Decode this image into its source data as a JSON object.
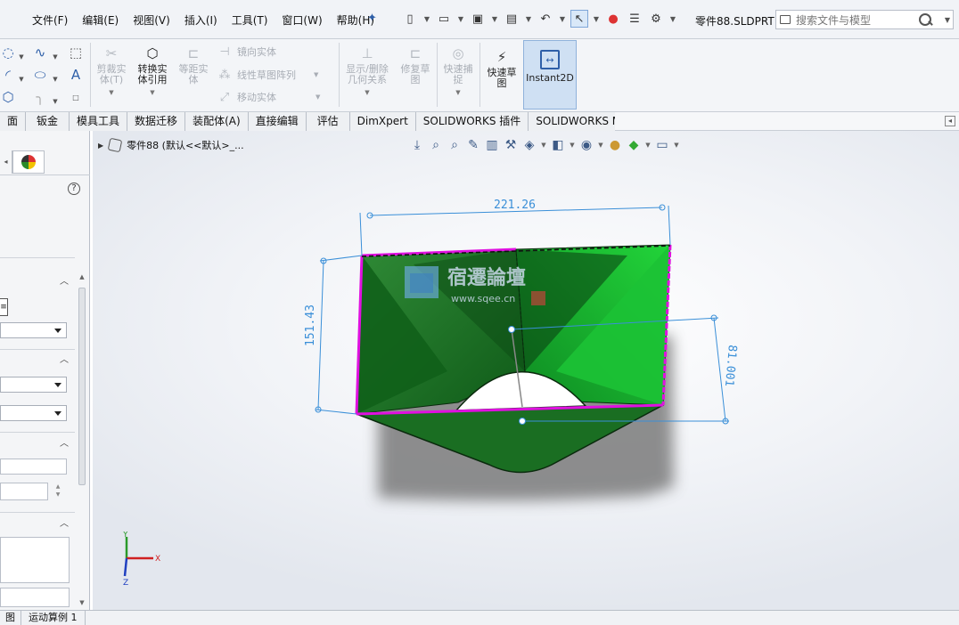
{
  "menus": [
    "文件(F)",
    "编辑(E)",
    "视图(V)",
    "插入(I)",
    "工具(T)",
    "窗口(W)",
    "帮助(H)"
  ],
  "doc_title": "零件88.SLDPRT *",
  "search": {
    "placeholder": "搜索文件与模型"
  },
  "ribbon": {
    "trim": "剪裁实\n体(T)",
    "convert": "转换实\n体引用",
    "offset": "等距实\n体",
    "mirror": "镜向实体",
    "linear_pattern": "线性草图阵列",
    "move": "移动实体",
    "display_relations": "显示/删除\n几何关系",
    "repair": "修复草\n图",
    "quick_snap": "快速捕\n捉",
    "rapid_sketch": "快速草\n图",
    "instant2d": "Instant2D"
  },
  "tabs": [
    "面",
    "钣金",
    "模具工具",
    "数据迁移",
    "装配体(A)",
    "直接编辑",
    "评估",
    "DimXpert",
    "SOLIDWORKS 插件",
    "SOLIDWORKS MBD"
  ],
  "tree": {
    "label": "零件88 (默认<<默认>_..."
  },
  "dimensions": {
    "width": "221.26",
    "height": "151.43",
    "depth": "81.001"
  },
  "watermark": {
    "title": "宿遷論壇",
    "url": "www.sqee.cn"
  },
  "triad": {
    "x": "X",
    "y": "Y",
    "z": "Z"
  },
  "bottom_tabs": [
    "图",
    "运动算例 1"
  ],
  "colors": {
    "model_green": "#1e7a24",
    "model_bright": "#16b832",
    "sketch_magenta": "#e010e0",
    "dim_blue": "#3a8fd8"
  }
}
